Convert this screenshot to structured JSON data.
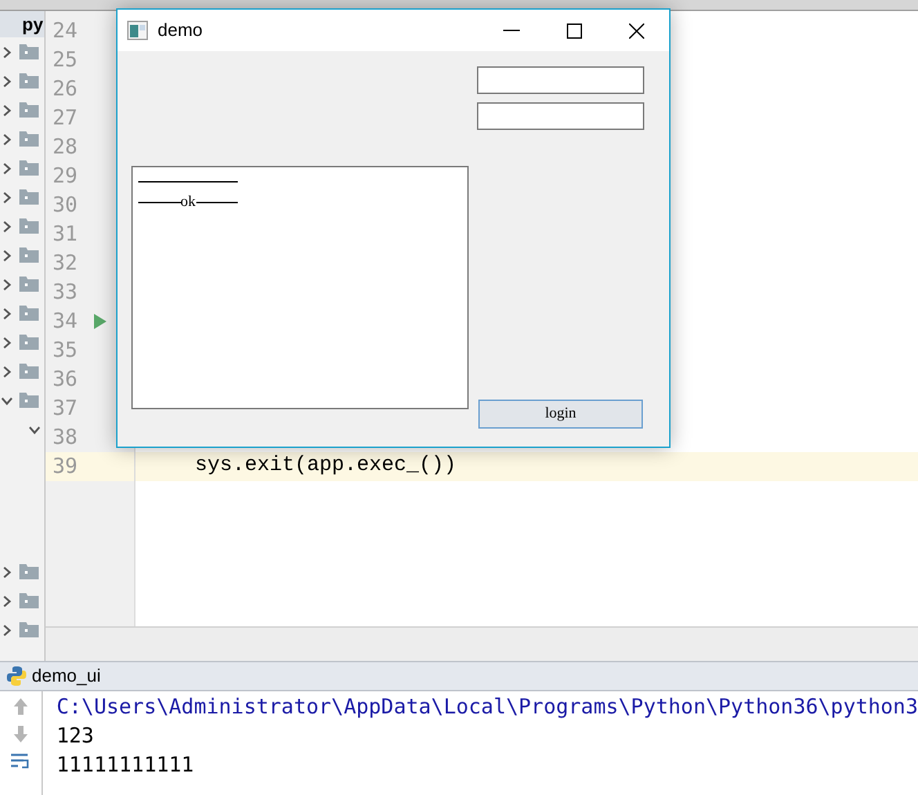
{
  "project_tree": {
    "header": "py",
    "items": [
      {
        "expanded": false
      },
      {
        "expanded": false
      },
      {
        "expanded": false
      },
      {
        "expanded": false
      },
      {
        "expanded": false
      },
      {
        "expanded": false
      },
      {
        "expanded": false
      },
      {
        "expanded": false
      },
      {
        "expanded": false
      },
      {
        "expanded": false
      },
      {
        "expanded": false
      },
      {
        "expanded": false
      },
      {
        "expanded": true,
        "children": [
          {
            "expanded": true
          }
        ]
      }
    ],
    "items_lower": [
      {
        "expanded": false
      },
      {
        "expanded": false
      },
      {
        "expanded": false
      }
    ]
  },
  "editor": {
    "lines": [
      {
        "number": "24"
      },
      {
        "number": "25"
      },
      {
        "number": "26"
      },
      {
        "number": "27"
      },
      {
        "number": "28"
      },
      {
        "number": "29"
      },
      {
        "number": "30"
      },
      {
        "number": "31"
      },
      {
        "number": "32"
      },
      {
        "number": "33"
      },
      {
        "number": "34",
        "run_marker": true
      },
      {
        "number": "35"
      },
      {
        "number": "36"
      },
      {
        "number": "37"
      },
      {
        "number": "38"
      },
      {
        "number": "39",
        "current": true,
        "code": "sys.exit(app.exec_())"
      }
    ]
  },
  "dialog": {
    "title": "demo",
    "fields": [
      {
        "kind": "text_input"
      },
      {
        "kind": "text_input"
      }
    ],
    "list_items": [
      {
        "kind": "separator"
      },
      {
        "kind": "titled_separator",
        "label": "ok"
      }
    ],
    "button": "login"
  },
  "run_panel": {
    "tab": "demo_ui",
    "lines": [
      {
        "kind": "command",
        "text": "C:\\Users\\Administrator\\AppData\\Local\\Programs\\Python\\Python36\\python3"
      },
      {
        "kind": "output",
        "text": "123"
      },
      {
        "kind": "output",
        "text": "11111111111"
      }
    ]
  }
}
